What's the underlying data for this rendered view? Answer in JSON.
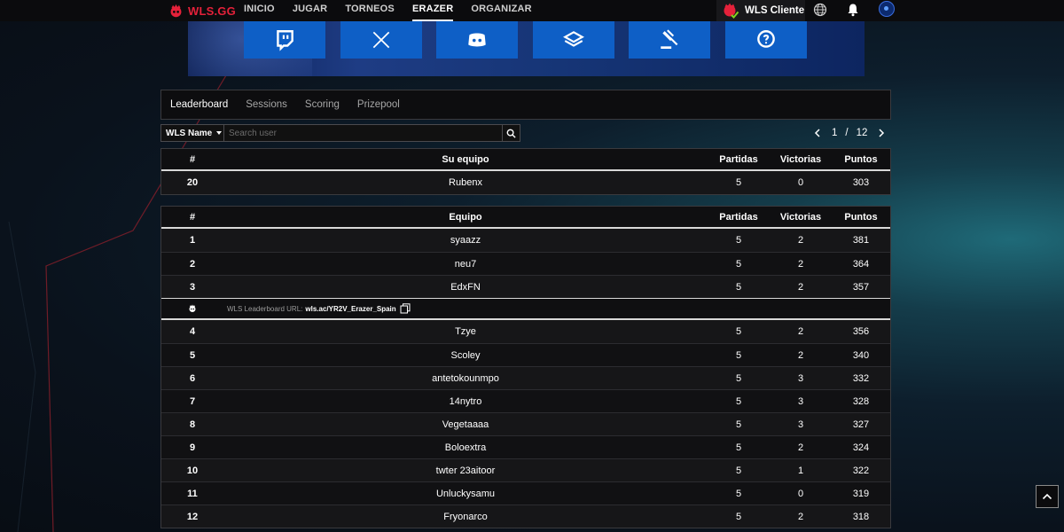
{
  "brand": {
    "name": "WLS.GG"
  },
  "nav": {
    "items": [
      {
        "label": "INICIO",
        "active": false
      },
      {
        "label": "JUGAR",
        "active": false
      },
      {
        "label": "TORNEOS",
        "active": false
      },
      {
        "label": "ERAZER",
        "active": true
      },
      {
        "label": "ORGANIZAR",
        "active": false
      }
    ],
    "client_label": "WLS Cliente"
  },
  "banner": {
    "social_icons": [
      "twitch-icon",
      "x-icon",
      "discord-icon",
      "layers-icon",
      "gavel-icon",
      "help-icon"
    ]
  },
  "tabs": [
    {
      "label": "Leaderboard",
      "active": true
    },
    {
      "label": "Sessions",
      "active": false
    },
    {
      "label": "Scoring",
      "active": false
    },
    {
      "label": "Prizepool",
      "active": false
    }
  ],
  "filter": {
    "dropdown_label": "WLS Name",
    "search_placeholder": "Search user"
  },
  "pager": {
    "current": "1",
    "separator": "/",
    "total": "12"
  },
  "my_team": {
    "headers": {
      "rank": "#",
      "team": "Su equipo",
      "matches": "Partidas",
      "wins": "Victorias",
      "points": "Puntos"
    },
    "row": {
      "rank": "20",
      "team": "Rubenx",
      "matches": "5",
      "wins": "0",
      "points": "303"
    }
  },
  "leaderboard": {
    "headers": {
      "rank": "#",
      "team": "Equipo",
      "matches": "Partidas",
      "wins": "Victorias",
      "points": "Puntos"
    },
    "rows_top": [
      {
        "rank": "1",
        "team": "syaazz",
        "matches": "5",
        "wins": "2",
        "points": "381"
      },
      {
        "rank": "2",
        "team": "neu7",
        "matches": "5",
        "wins": "2",
        "points": "364"
      },
      {
        "rank": "3",
        "team": "EdxFN",
        "matches": "5",
        "wins": "2",
        "points": "357"
      }
    ],
    "url_label": "WLS Leaderboard URL:",
    "url_value": "wls.ac/YR2V_Erazer_Spain",
    "rows_rest": [
      {
        "rank": "4",
        "team": "Tzye",
        "matches": "5",
        "wins": "2",
        "points": "356"
      },
      {
        "rank": "5",
        "team": "Scoley",
        "matches": "5",
        "wins": "2",
        "points": "340"
      },
      {
        "rank": "6",
        "team": "antetokounmpo",
        "matches": "5",
        "wins": "3",
        "points": "332"
      },
      {
        "rank": "7",
        "team": "14nytro",
        "matches": "5",
        "wins": "3",
        "points": "328"
      },
      {
        "rank": "8",
        "team": "Vegetaaaa",
        "matches": "5",
        "wins": "3",
        "points": "327"
      },
      {
        "rank": "9",
        "team": "Boloextra",
        "matches": "5",
        "wins": "2",
        "points": "324"
      },
      {
        "rank": "10",
        "team": "twter 23aitoor",
        "matches": "5",
        "wins": "1",
        "points": "322"
      },
      {
        "rank": "11",
        "team": "Unluckysamu",
        "matches": "5",
        "wins": "0",
        "points": "319"
      },
      {
        "rank": "12",
        "team": "Fryonarco",
        "matches": "5",
        "wins": "2",
        "points": "318"
      }
    ]
  },
  "colors": {
    "brand_red": "#e5213a",
    "social_blue": "#0e5fc6",
    "panel_bg": "#111113"
  }
}
